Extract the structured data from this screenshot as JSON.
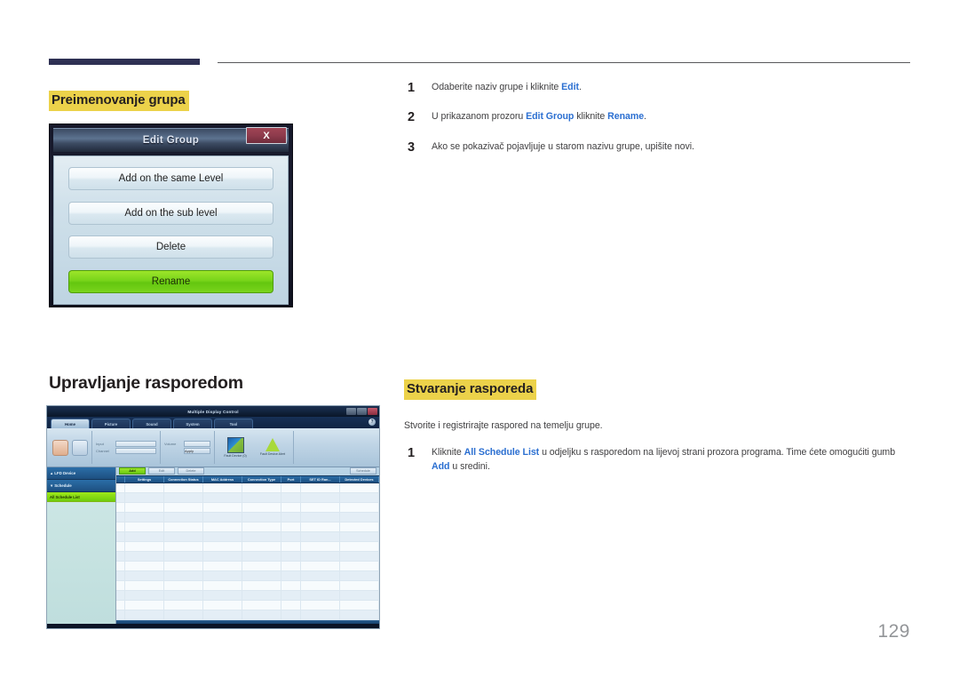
{
  "page": {
    "number": "129"
  },
  "sections": {
    "rename_groups": {
      "heading": "Preimenovanje grupa",
      "steps": [
        {
          "num": "1",
          "parts": [
            {
              "t": "Odaberite naziv grupe i kliknite ",
              "b": false
            },
            {
              "t": "Edit",
              "b": true
            },
            {
              "t": ".",
              "b": false
            }
          ]
        },
        {
          "num": "2",
          "parts": [
            {
              "t": "U prikazanom prozoru ",
              "b": false
            },
            {
              "t": "Edit Group",
              "b": true
            },
            {
              "t": " kliknite ",
              "b": false
            },
            {
              "t": "Rename",
              "b": true
            },
            {
              "t": ".",
              "b": false
            }
          ]
        },
        {
          "num": "3",
          "parts": [
            {
              "t": "Ako se pokazivač pojavljuje u starom nazivu grupe, upišite novi.",
              "b": false
            }
          ]
        }
      ]
    },
    "schedule_management": {
      "heading": "Upravljanje rasporedom"
    },
    "create_schedule": {
      "heading": "Stvaranje rasporeda",
      "lead": "Stvorite i registrirajte raspored na temelju grupe.",
      "steps": [
        {
          "num": "1",
          "parts": [
            {
              "t": "Kliknite ",
              "b": false
            },
            {
              "t": "All Schedule List",
              "b": true
            },
            {
              "t": " u odjeljku s rasporedom na lijevoj strani prozora programa. Time ćete omogućiti gumb ",
              "b": false
            },
            {
              "t": "Add",
              "b": true
            },
            {
              "t": " u sredini.",
              "b": false
            }
          ]
        }
      ]
    }
  },
  "edit_group_dialog": {
    "title": "Edit Group",
    "close_label": "X",
    "buttons": [
      {
        "label": "Add on the same Level",
        "primary": false
      },
      {
        "label": "Add on the sub level",
        "primary": false
      },
      {
        "label": "Delete",
        "primary": false
      },
      {
        "label": "Rename",
        "primary": true
      }
    ]
  },
  "mdc_screenshot": {
    "window_title": "Multiple Display Control",
    "help_glyph": "?",
    "tabs": [
      {
        "label": "Home",
        "active": true
      },
      {
        "label": "Picture",
        "active": false
      },
      {
        "label": "Sound",
        "active": false
      },
      {
        "label": "System",
        "active": false
      },
      {
        "label": "Tool",
        "active": false
      }
    ],
    "ribbon": {
      "fields": [
        {
          "label": "Input"
        },
        {
          "label": "Channel"
        },
        {
          "label": "Volume"
        }
      ],
      "apply_label": "Apply",
      "big_icons": [
        {
          "caption": "Fault Device (0)"
        },
        {
          "caption": "Fault Device Alert"
        }
      ]
    },
    "sidebar": [
      {
        "label": "LFD Device",
        "type": "header",
        "chevron": "▴"
      },
      {
        "label": "Schedule",
        "type": "header",
        "chevron": "▾"
      },
      {
        "label": "All Schedule List",
        "type": "item-selected"
      }
    ],
    "action_buttons": [
      {
        "label": "Add",
        "style": "green"
      },
      {
        "label": "Edit",
        "style": "plain"
      },
      {
        "label": "Delete",
        "style": "plain"
      },
      {
        "label": "Schedule",
        "style": "plain-right"
      }
    ],
    "table_headers": [
      "Settings",
      "Connection Status",
      "MAC Address",
      "Connection Type",
      "Port",
      "SET ID Ran...",
      "Detected Devices"
    ],
    "table_rows": 14
  },
  "colors": {
    "highlight": "#ecd24a",
    "link": "#2b6fd1",
    "rule_dark": "#2e3053",
    "green": "#7ad41c",
    "page_num": "#939598"
  }
}
